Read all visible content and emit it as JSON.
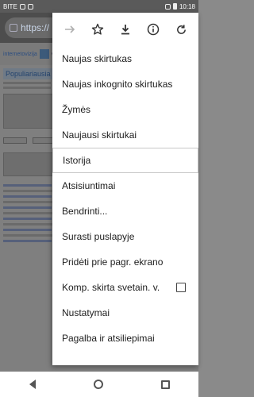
{
  "statusbar": {
    "carrier": "BITE",
    "time": "10:18",
    "battery": "80"
  },
  "browser": {
    "url": "https://"
  },
  "background_page": {
    "site_name": "internetovizija",
    "site_brand": "vizija",
    "section_title": "Populiariausia viet"
  },
  "menu": {
    "toolbar": [
      {
        "name": "forward-icon",
        "glyph": "→"
      },
      {
        "name": "bookmark-star-icon",
        "glyph": "☆"
      },
      {
        "name": "download-icon",
        "glyph": "⬇"
      },
      {
        "name": "info-icon",
        "glyph": "ⓘ"
      },
      {
        "name": "refresh-icon",
        "glyph": "↻"
      }
    ],
    "items": [
      {
        "label": "Naujas skirtukas"
      },
      {
        "label": "Naujas inkognito skirtukas"
      },
      {
        "label": "Žymės"
      },
      {
        "label": "Naujausi skirtukai"
      },
      {
        "label": "Istorija"
      },
      {
        "label": "Atsisiuntimai"
      },
      {
        "label": "Bendrinti..."
      },
      {
        "label": "Surasti puslapyje"
      },
      {
        "label": "Pridėti prie pagr. ekrano"
      },
      {
        "label": "Komp. skirta svetain. v."
      },
      {
        "label": "Nustatymai"
      },
      {
        "label": "Pagalba ir atsiliepimai"
      }
    ]
  }
}
